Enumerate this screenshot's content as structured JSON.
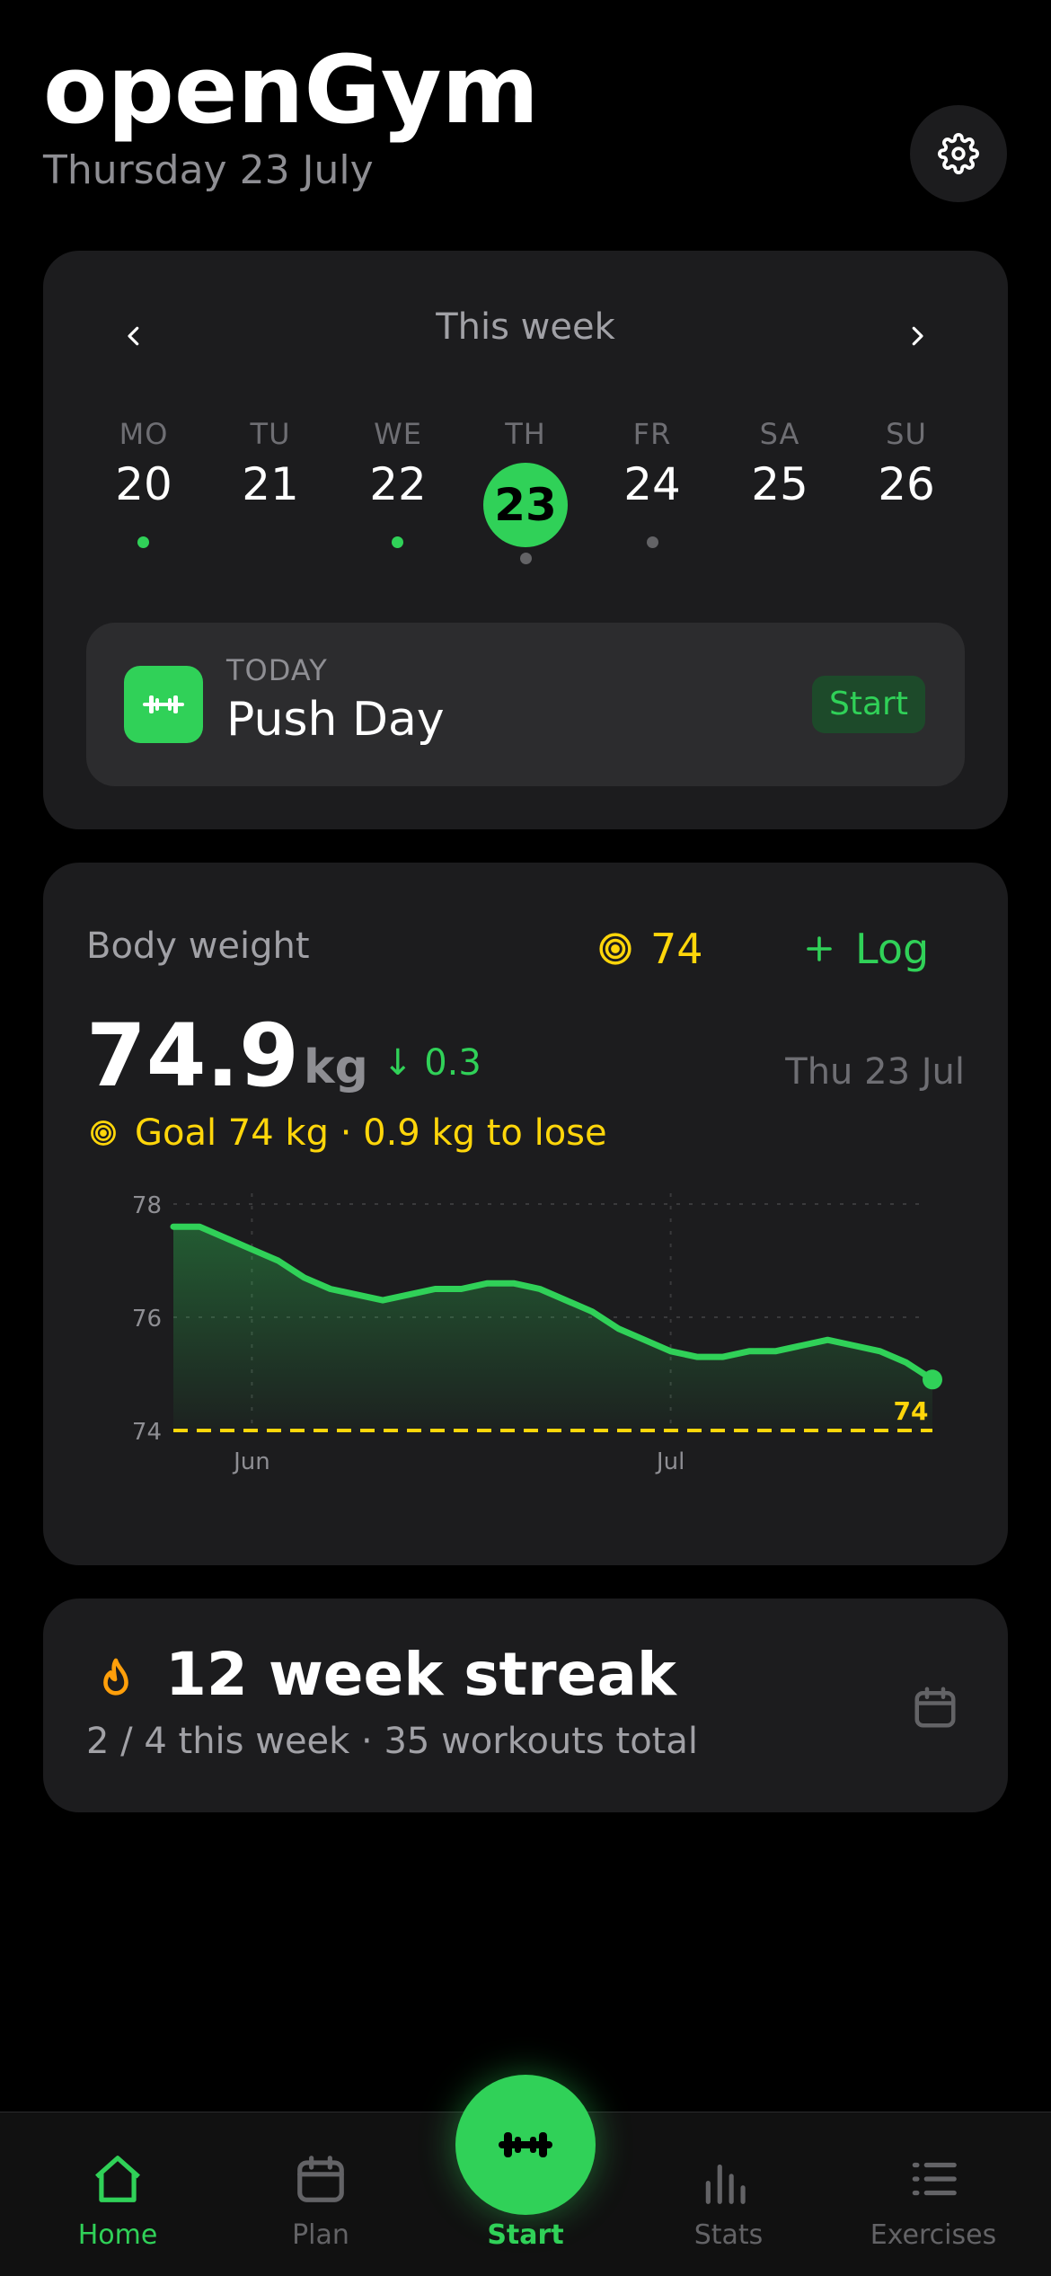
{
  "header": {
    "app_title": "openGym",
    "date": "Thursday 23 July"
  },
  "week_card": {
    "title": "This week",
    "days": [
      {
        "label": "MO",
        "num": "20",
        "marker": "done"
      },
      {
        "label": "TU",
        "num": "21",
        "marker": "none"
      },
      {
        "label": "WE",
        "num": "22",
        "marker": "done"
      },
      {
        "label": "TH",
        "num": "23",
        "marker": "planned",
        "selected": true
      },
      {
        "label": "FR",
        "num": "24",
        "marker": "planned"
      },
      {
        "label": "SA",
        "num": "25",
        "marker": "none"
      },
      {
        "label": "SU",
        "num": "26",
        "marker": "none"
      }
    ],
    "today": {
      "label": "TODAY",
      "workout": "Push Day",
      "start_label": "Start"
    }
  },
  "weight_card": {
    "title": "Body weight",
    "goal_badge": "74",
    "log_label": "Log",
    "value": "74.9",
    "unit": "kg",
    "change": "0.3",
    "date": "Thu 23 Jul",
    "goal_text": "Goal 74 kg · 0.9 kg to lose"
  },
  "chart_data": {
    "type": "area",
    "y_ticks": [
      "78",
      "76",
      "74"
    ],
    "ylim": [
      74,
      78
    ],
    "x_ticks": [
      "Jun",
      "Jul"
    ],
    "values": [
      77.6,
      77.6,
      77.4,
      77.2,
      77.0,
      76.7,
      76.5,
      76.4,
      76.3,
      76.4,
      76.5,
      76.5,
      76.6,
      76.6,
      76.5,
      76.3,
      76.1,
      75.8,
      75.6,
      75.4,
      75.3,
      75.3,
      75.4,
      75.4,
      75.5,
      75.6,
      75.5,
      75.4,
      75.2,
      74.9
    ],
    "goal_line": 74,
    "goal_label": "74",
    "colors": {
      "line": "#30d158",
      "goal": "#ffd60a"
    }
  },
  "streak_card": {
    "title": "12 week streak",
    "subtitle": "2 / 4 this week · 35 workouts total"
  },
  "bottom_nav": {
    "items": [
      {
        "label": "Home",
        "icon": "home-icon",
        "active": true
      },
      {
        "label": "Plan",
        "icon": "calendar-icon"
      },
      {
        "label": "Start",
        "icon": "dumbbell-icon"
      },
      {
        "label": "Stats",
        "icon": "bar-chart-icon"
      },
      {
        "label": "Exercises",
        "icon": "list-icon"
      }
    ]
  }
}
